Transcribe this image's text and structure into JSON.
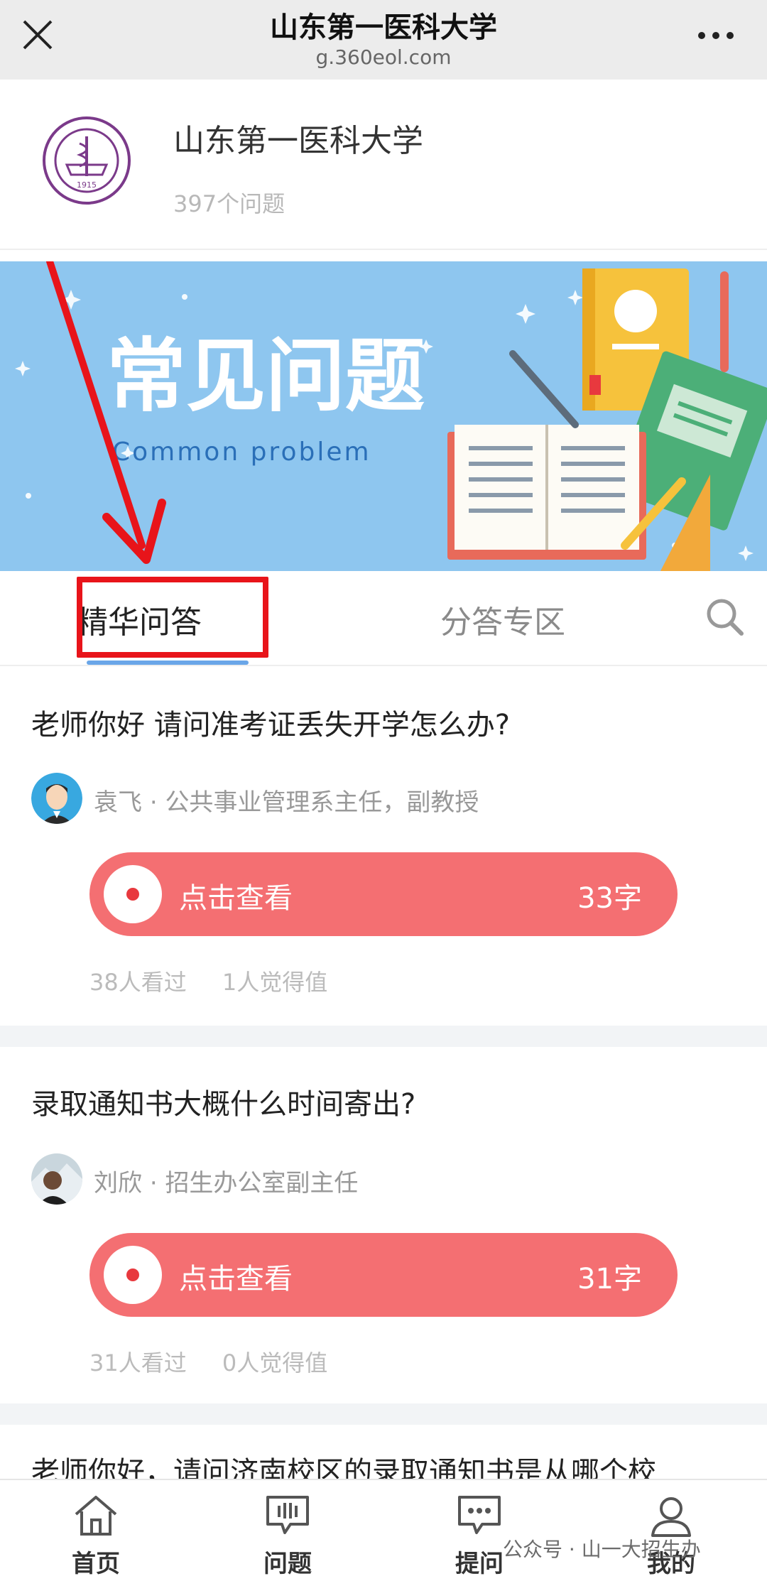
{
  "topbar": {
    "title": "山东第一医科大学",
    "url": "g.360eol.com"
  },
  "profile": {
    "name": "山东第一医科大学",
    "count": "397个问题",
    "logo_year": "1915"
  },
  "banner": {
    "title": "常见问题",
    "subtitle": "Common problem"
  },
  "tabs": [
    {
      "label": "精华问答",
      "active": true
    },
    {
      "label": "分答专区",
      "active": false
    }
  ],
  "questions": [
    {
      "question": "老师你好 请问准考证丢失开学怎么办?",
      "author": "袁飞",
      "title": "公共事业管理系主任，副教授",
      "play_label": "点击查看",
      "length": "33字",
      "views": "38人看过",
      "likes": "1人觉得值"
    },
    {
      "question": "录取通知书大概什么时间寄出?",
      "author": "刘欣",
      "title": "招生办公室副主任",
      "play_label": "点击查看",
      "length": "31字",
      "views": "31人看过",
      "likes": "0人觉得值"
    }
  ],
  "cutoff_question": "老师你好，请问济南校区的录取通知书是从哪个校",
  "tabbar": [
    {
      "label": "首页",
      "icon": "home-icon"
    },
    {
      "label": "问题",
      "icon": "question-chat-icon"
    },
    {
      "label": "提问",
      "icon": "ask-chat-icon"
    },
    {
      "label": "我的",
      "icon": "user-icon"
    }
  ],
  "watermark": "公众号 · 山一大招生办",
  "colors": {
    "accent_blue": "#6aa6e8",
    "play_pink": "#f46f72",
    "highlight_red": "#e8141a",
    "banner_blue": "#8ec6ef"
  }
}
